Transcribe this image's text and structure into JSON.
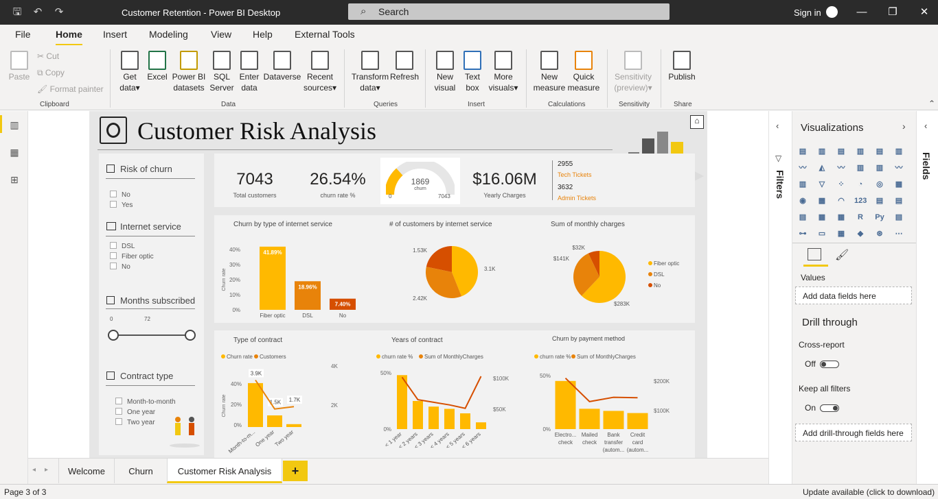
{
  "window": {
    "title": "Customer Retention - Power BI Desktop",
    "search_placeholder": "Search",
    "sign_in": "Sign in"
  },
  "menu": [
    "File",
    "Home",
    "Insert",
    "Modeling",
    "View",
    "Help",
    "External Tools"
  ],
  "ribbon": {
    "clipboard": {
      "paste": "Paste",
      "cut": "Cut",
      "copy": "Copy",
      "format_painter": "Format painter",
      "group": "Clipboard"
    },
    "data": {
      "get_data": [
        "Get",
        "data"
      ],
      "excel": "Excel",
      "powerbi": [
        "Power BI",
        "datasets"
      ],
      "sql": [
        "SQL",
        "Server"
      ],
      "enter": [
        "Enter",
        "data"
      ],
      "dataverse": "Dataverse",
      "recent": [
        "Recent",
        "sources"
      ],
      "group": "Data"
    },
    "queries": {
      "transform": [
        "Transform",
        "data"
      ],
      "refresh": "Refresh",
      "group": "Queries"
    },
    "insert": {
      "new_visual": [
        "New",
        "visual"
      ],
      "text_box": [
        "Text",
        "box"
      ],
      "more_visuals": [
        "More",
        "visuals"
      ],
      "group": "Insert"
    },
    "calculations": {
      "new_measure": [
        "New",
        "measure"
      ],
      "quick_measure": [
        "Quick",
        "measure"
      ],
      "group": "Calculations"
    },
    "sensitivity": {
      "label": [
        "Sensitivity",
        "(preview)"
      ],
      "group": "Sensitivity"
    },
    "share": {
      "publish": "Publish",
      "group": "Share"
    }
  },
  "report": {
    "title": "Customer Risk Analysis",
    "slicers": {
      "risk": {
        "title": "Risk of churn",
        "options": [
          "No",
          "Yes"
        ]
      },
      "internet": {
        "title": "Internet service",
        "options": [
          "DSL",
          "Fiber optic",
          "No"
        ]
      },
      "months": {
        "title": "Months subscribed",
        "min": "0",
        "max": "72"
      },
      "contract": {
        "title": "Contract type",
        "options": [
          "Month-to-month",
          "One year",
          "Two year"
        ]
      }
    },
    "kpis": {
      "total_customers": "7043",
      "total_customers_label": "Total customers",
      "churn_rate": "26.54%",
      "churn_rate_label": "churn rate %",
      "gauge_value": "1869",
      "gauge_label": "churn",
      "gauge_min": "0",
      "gauge_max": "7043",
      "yearly_charges": "$16.06M",
      "yearly_charges_label": "Yearly Charges",
      "tech_tickets": "2955",
      "tech_tickets_label": "Tech Tickets",
      "admin_tickets": "3632",
      "admin_tickets_label": "Admin Tickets"
    },
    "visual_titles": {
      "churn_internet": "Churn by type of internet service",
      "customers_internet": "# of customers by internet service",
      "monthly_charges": "Sum of monthly charges",
      "contract": "Type of contract",
      "years": "Years of contract",
      "payment": "Churn by payment method"
    },
    "legends": {
      "contract": [
        "Churn rate",
        "Customers"
      ],
      "years": [
        "churn rate %",
        "Sum of MonthlyCharges"
      ],
      "payment": [
        "churn rate %",
        "Sum of MonthlyCharges"
      ],
      "monthly": [
        "Fiber optic",
        "DSL",
        "No"
      ]
    },
    "axis_labels": {
      "churn_rate": "Churn rate"
    }
  },
  "chart_data": [
    {
      "type": "bar",
      "title": "Churn by type of internet service",
      "categories": [
        "Fiber optic",
        "DSL",
        "No"
      ],
      "values": [
        41.89,
        18.96,
        7.4
      ],
      "data_labels": [
        "41.89%",
        "18.96%",
        "7.40%"
      ],
      "ylabel": "Churn rate",
      "ylim": [
        0,
        40
      ],
      "yticks": [
        "40%",
        "30%",
        "20%",
        "10%",
        "0%"
      ]
    },
    {
      "type": "pie",
      "title": "# of customers by internet service",
      "categories": [
        "Fiber optic",
        "DSL",
        "No"
      ],
      "values": [
        3100,
        2420,
        1530
      ],
      "data_labels": [
        "3.1K",
        "2.42K",
        "1.53K"
      ]
    },
    {
      "type": "pie",
      "title": "Sum of monthly charges",
      "categories": [
        "Fiber optic",
        "DSL",
        "No"
      ],
      "values": [
        283,
        141,
        32
      ],
      "data_labels": [
        "$283K",
        "$141K",
        "$32K"
      ]
    },
    {
      "type": "bar",
      "title": "Type of contract",
      "categories": [
        "Month-to-m...",
        "One year",
        "Two year"
      ],
      "series": [
        {
          "name": "Churn rate",
          "values": [
            42.7,
            11.3,
            2.8
          ]
        },
        {
          "name": "Customers",
          "values": [
            3900,
            1500,
            1700
          ]
        }
      ],
      "data_labels": [
        "3.9K",
        "1.5K",
        "1.7K"
      ],
      "ylabel": "Churn rate",
      "yticks": [
        "40%",
        "20%",
        "0%"
      ],
      "y2ticks": [
        "4K",
        "2K"
      ]
    },
    {
      "type": "bar",
      "title": "Years of contract",
      "categories": [
        "< 1 year",
        "< 2 years",
        "< 3 years",
        "< 4 years",
        "< 5 years",
        "< 6 years"
      ],
      "series": [
        {
          "name": "churn rate %",
          "values": [
            48,
            25,
            20,
            18,
            14,
            6
          ]
        },
        {
          "name": "Sum of MonthlyCharges",
          "values": [
            120,
            68,
            62,
            56,
            48,
            122
          ]
        }
      ],
      "yticks": [
        "50%",
        "0%"
      ],
      "y2ticks": [
        "$100K",
        "$50K"
      ]
    },
    {
      "type": "bar",
      "title": "Churn by payment method",
      "categories": [
        "Electro... check",
        "Mailed check",
        "Bank transfer (autom...",
        "Credit card (autom..."
      ],
      "series": [
        {
          "name": "churn rate %",
          "values": [
            45,
            19,
            17,
            15
          ]
        },
        {
          "name": "Sum of MonthlyCharges",
          "values": [
            200,
            108,
            125,
            123
          ]
        }
      ],
      "yticks": [
        "50%",
        "0%"
      ],
      "y2ticks": [
        "$200K",
        "$100K"
      ]
    }
  ],
  "panes": {
    "filters": "Filters",
    "visualizations": "Visualizations",
    "fields": "Fields",
    "values": "Values",
    "add_data_fields": "Add data fields here",
    "drill_through": "Drill through",
    "cross_report": "Cross-report",
    "off": "Off",
    "keep_filters": "Keep all filters",
    "on": "On",
    "add_drill": "Add drill-through fields here"
  },
  "tabs": [
    "Welcome",
    "Churn",
    "Customer Risk Analysis"
  ],
  "status": {
    "page": "Page 3 of 3",
    "update": "Update available (click to download)"
  },
  "colors": {
    "accent": "#f2c811",
    "bar": "#ffb900",
    "orange": "#e8830a",
    "red": "#d64f00"
  }
}
